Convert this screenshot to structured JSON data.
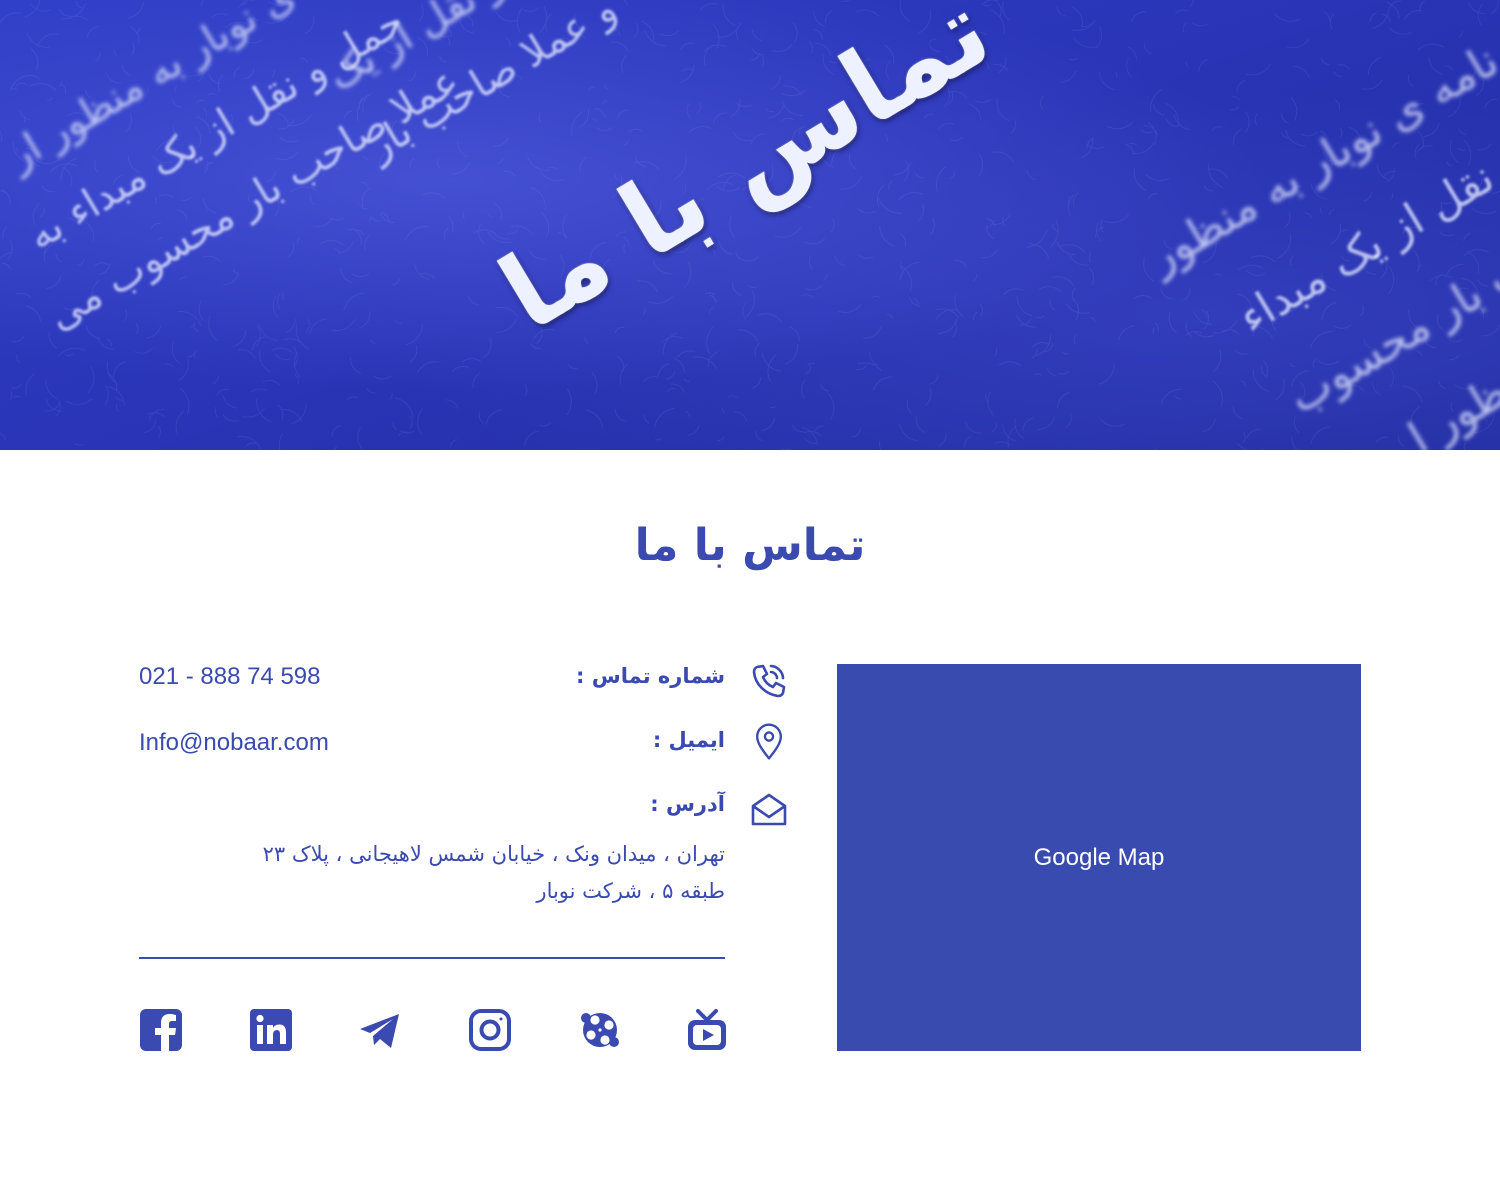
{
  "hero": {
    "title": "تماس با ما",
    "background_text": [
      "که در برنامه ی نوبار به منظور",
      "ت حمل و نقل از یک مبداء",
      "عملا صاحب بار محسوب",
      "ی نوبار به منظور ا",
      "عملا صاحب بار محسوب می",
      "حمل و نقل از یک مبداء به",
      "ی نوبار به منظور ار",
      "و عملا صاحب بار",
      "حمل و نقل از یک"
    ]
  },
  "section_title": "تماس با ما",
  "contact": {
    "phone": {
      "label": "شماره تماس :",
      "value": "021 - 888 74 598",
      "icon": "phone-icon"
    },
    "email": {
      "label": "ایمیل :",
      "value": "Info@nobaar.com",
      "icon": "location-pin-icon"
    },
    "address": {
      "label": "آدرس :",
      "line1": "تهران ، میدان ونک ، خیابان شمس لاهیجانی ، پلاک ۲۳",
      "line2": "طبقه ۵ ، شرکت نوبار",
      "icon": "envelope-icon"
    }
  },
  "social": [
    "facebook-icon",
    "linkedin-icon",
    "telegram-icon",
    "instagram-icon",
    "aparat-icon",
    "tv-icon"
  ],
  "map": {
    "label": "Google Map"
  },
  "colors": {
    "brand": "#3a4ab0",
    "map_bg": "#3a4bb0",
    "hero_bg": "#2a35b8"
  }
}
